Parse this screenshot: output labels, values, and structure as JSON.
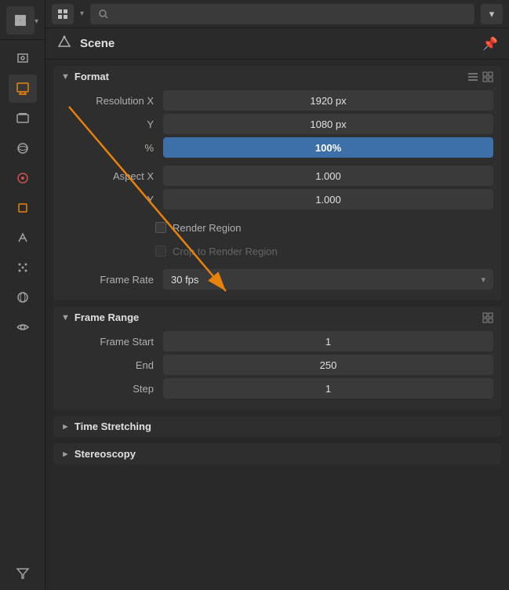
{
  "topbar": {
    "search_placeholder": "🔍"
  },
  "props_header": {
    "icon": "🎬",
    "title": "Scene"
  },
  "format_section": {
    "title": "Format",
    "fields": [
      {
        "label": "Resolution X",
        "value": "1920 px",
        "active": false
      },
      {
        "label": "Y",
        "value": "1080 px",
        "active": false
      },
      {
        "label": "%",
        "value": "100%",
        "active": true
      }
    ],
    "aspect_fields": [
      {
        "label": "Aspect X",
        "value": "1.000",
        "active": false
      },
      {
        "label": "Y",
        "value": "1.000",
        "active": false
      }
    ],
    "checkboxes": [
      {
        "label": "Render Region",
        "disabled": false,
        "checked": false
      },
      {
        "label": "Crop to Render Region",
        "disabled": true,
        "checked": false
      }
    ],
    "frame_rate_label": "Frame Rate",
    "frame_rate_value": "30 fps"
  },
  "frame_range_section": {
    "title": "Frame Range",
    "fields": [
      {
        "label": "Frame Start",
        "value": "1"
      },
      {
        "label": "End",
        "value": "250"
      },
      {
        "label": "Step",
        "value": "1"
      }
    ]
  },
  "time_stretching": {
    "title": "Time Stretching",
    "collapsed": true
  },
  "stereoscopy": {
    "title": "Stereoscopy"
  },
  "sidebar_icons": [
    {
      "icon": "⬛",
      "name": "layout-icon",
      "active": false
    },
    {
      "icon": "🎬",
      "name": "scene-icon",
      "active": false
    },
    {
      "icon": "🖨",
      "name": "output-icon",
      "active": true,
      "highlight": false
    },
    {
      "icon": "🖼",
      "name": "view-layer-icon",
      "active": false
    },
    {
      "icon": "🌅",
      "name": "scene-data-icon",
      "active": false
    },
    {
      "icon": "🔴",
      "name": "world-icon",
      "active": false
    },
    {
      "icon": "⬜",
      "name": "object-icon",
      "active": false
    },
    {
      "icon": "🔧",
      "name": "modifier-icon",
      "active": false
    },
    {
      "icon": "✳",
      "name": "particles-icon",
      "active": false
    },
    {
      "icon": "⭕",
      "name": "physics-icon",
      "active": false
    },
    {
      "icon": "🔮",
      "name": "constraints-icon",
      "active": false
    },
    {
      "icon": "▽",
      "name": "funnel-icon",
      "active": false
    }
  ]
}
